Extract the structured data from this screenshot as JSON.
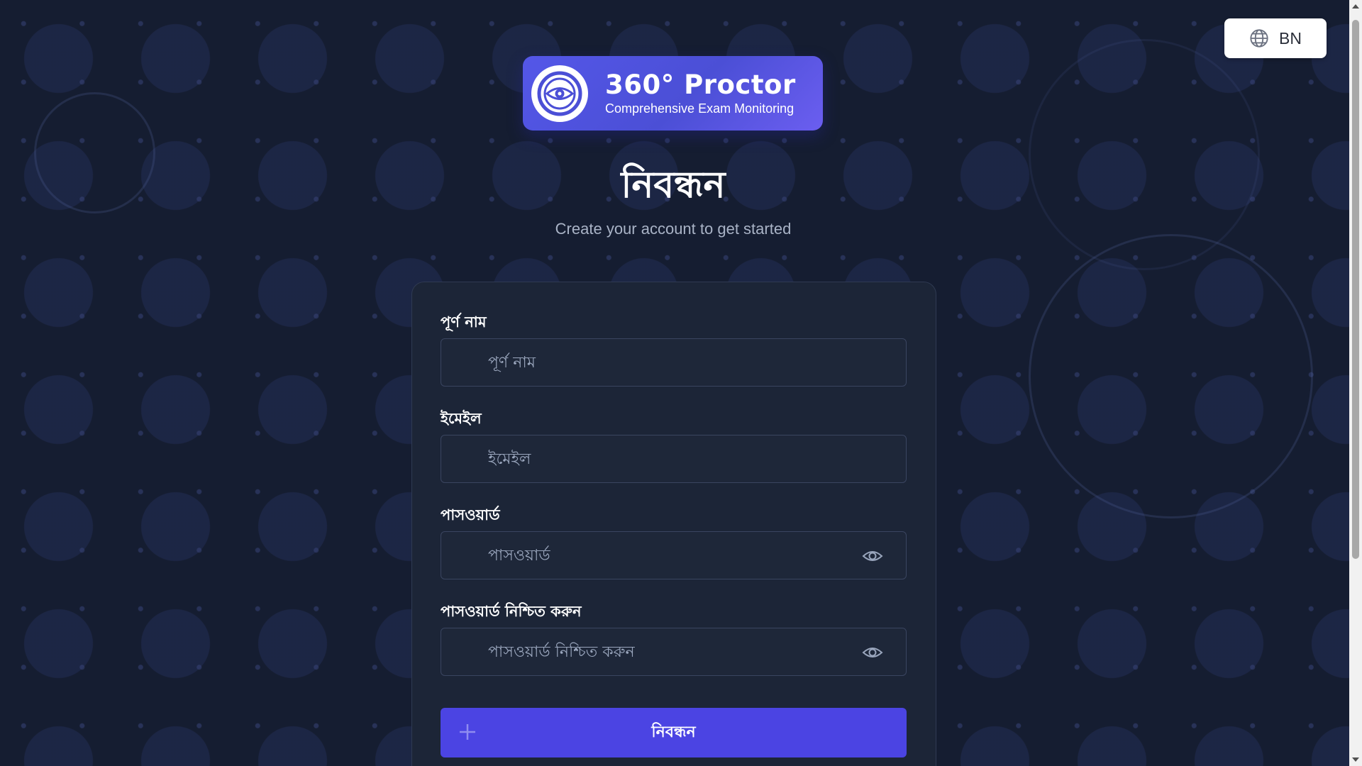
{
  "language_switcher": {
    "label": "BN",
    "icon": "globe-icon"
  },
  "brand": {
    "title": "360° Proctor",
    "subtitle": "Comprehensive Exam Monitoring",
    "logo_icon": "eye-target-icon",
    "accent_color": "#4f52e0"
  },
  "header": {
    "title": "নিবন্ধন",
    "subtitle": "Create your account to get started"
  },
  "form": {
    "full_name": {
      "label": "পূর্ণ নাম",
      "placeholder": "পূর্ণ নাম",
      "value": ""
    },
    "email": {
      "label": "ইমেইল",
      "placeholder": "ইমেইল",
      "value": ""
    },
    "password": {
      "label": "পাসওয়ার্ড",
      "placeholder": "পাসওয়ার্ড",
      "value": "",
      "toggle_icon": "eye-icon"
    },
    "confirm_password": {
      "label": "পাসওয়ার্ড নিশ্চিত করুন",
      "placeholder": "পাসওয়ার্ড নিশ্চিত করুন",
      "value": "",
      "toggle_icon": "eye-icon"
    },
    "submit": {
      "label": "নিবন্ধন",
      "icon": "plus-icon",
      "color": "#4b44e3"
    }
  }
}
